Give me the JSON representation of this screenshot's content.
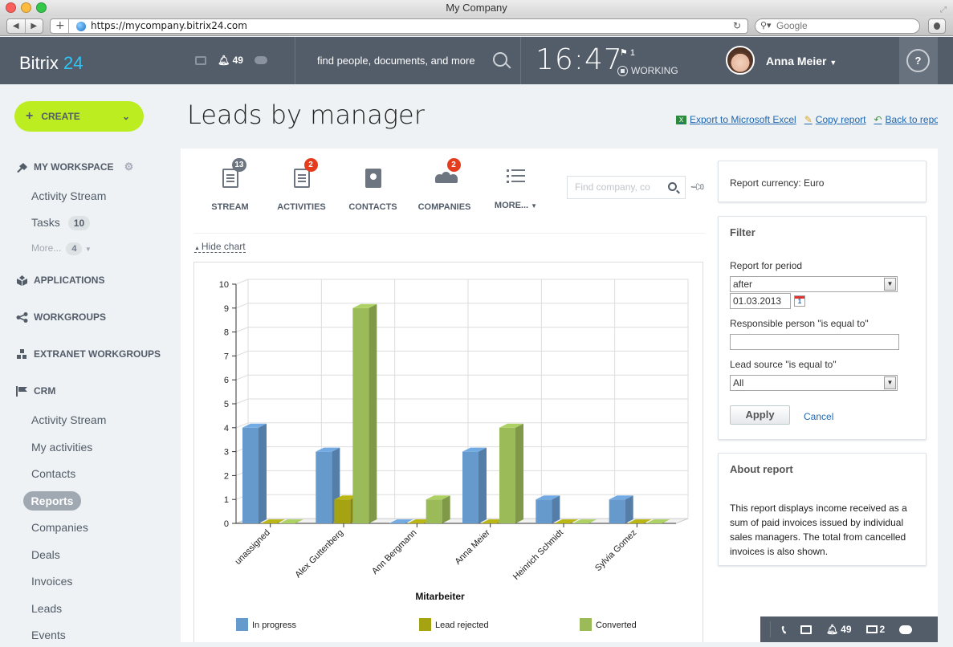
{
  "browser": {
    "window_title": "My Company",
    "url": "https://mycompany.bitrix24.com",
    "search_placeholder": "Google"
  },
  "header": {
    "logo_text": "Bitrix",
    "logo_num": "24",
    "notifications_count": "49",
    "search_placeholder": "find people, documents, and more",
    "time": "16:47",
    "flag_count": "1",
    "work_status": "WORKING",
    "user_name": "Anna Meier",
    "help_label": "?"
  },
  "sidebar": {
    "create_label": "CREATE",
    "sections": [
      {
        "label": "MY WORKSPACE"
      },
      {
        "label": "APPLICATIONS"
      },
      {
        "label": "WORKGROUPS"
      },
      {
        "label": "EXTRANET WORKGROUPS"
      },
      {
        "label": "CRM"
      }
    ],
    "workspace_items": [
      {
        "label": "Activity Stream"
      },
      {
        "label": "Tasks",
        "badge": "10"
      },
      {
        "label": "More...",
        "badge": "4"
      }
    ],
    "crm_items": [
      {
        "label": "Activity Stream"
      },
      {
        "label": "My activities"
      },
      {
        "label": "Contacts"
      },
      {
        "label": "Reports",
        "active": true
      },
      {
        "label": "Companies"
      },
      {
        "label": "Deals"
      },
      {
        "label": "Invoices"
      },
      {
        "label": "Leads"
      },
      {
        "label": "Events"
      }
    ]
  },
  "page": {
    "title": "Leads by manager",
    "actions": {
      "export": "Export to Microsoft Excel",
      "copy": "Copy report",
      "back": "Back to reports"
    }
  },
  "crm_tabs": [
    {
      "label": "STREAM",
      "count": "13",
      "count_color": "#6c7580"
    },
    {
      "label": "ACTIVITIES",
      "count": "2",
      "count_color": "#e63c1e"
    },
    {
      "label": "CONTACTS"
    },
    {
      "label": "COMPANIES",
      "count": "2",
      "count_color": "#e63c1e"
    },
    {
      "label": "MORE..."
    }
  ],
  "crm_search_placeholder": "Find company, co",
  "hide_chart_label": "Hide chart",
  "right_panel": {
    "currency": "Report currency: Euro",
    "filter_title": "Filter",
    "period_label": "Report for period",
    "period_value": "after",
    "date_value": "01.03.2013",
    "calendar_day": "1",
    "responsible_label": "Responsible person \"is equal to\"",
    "responsible_value": "",
    "source_label": "Lead source \"is equal to\"",
    "source_value": "All",
    "apply_label": "Apply",
    "cancel_label": "Cancel",
    "about_title": "About report",
    "about_text": "This report displays income received as a sum of paid invoices issued by individual sales managers. The total from cancelled invoices is also shown."
  },
  "bottom_bar": {
    "notifications_count": "49",
    "mail_count": "2"
  },
  "chart_data": {
    "type": "bar",
    "title": "",
    "xlabel": "Mitarbeiter",
    "ylabel": "",
    "ylim": [
      0,
      10
    ],
    "yticks": [
      0,
      1,
      2,
      3,
      4,
      5,
      6,
      7,
      8,
      9,
      10
    ],
    "grid": true,
    "legend_position": "bottom",
    "categories": [
      "unassigned",
      "Alex Guttenberg",
      "Ann Bergmann",
      "Anna Meier",
      "Heinrich Schmidt",
      "Sylvia Gomez"
    ],
    "series": [
      {
        "name": "In progress",
        "color": "#6699cc",
        "values": [
          4,
          3,
          0,
          3,
          1,
          1
        ]
      },
      {
        "name": "Lead rejected",
        "color": "#a6a313",
        "values": [
          0,
          1,
          0,
          0,
          0,
          0
        ]
      },
      {
        "name": "Converted",
        "color": "#9bbb59",
        "values": [
          0,
          9,
          1,
          4,
          0,
          0
        ]
      }
    ]
  }
}
